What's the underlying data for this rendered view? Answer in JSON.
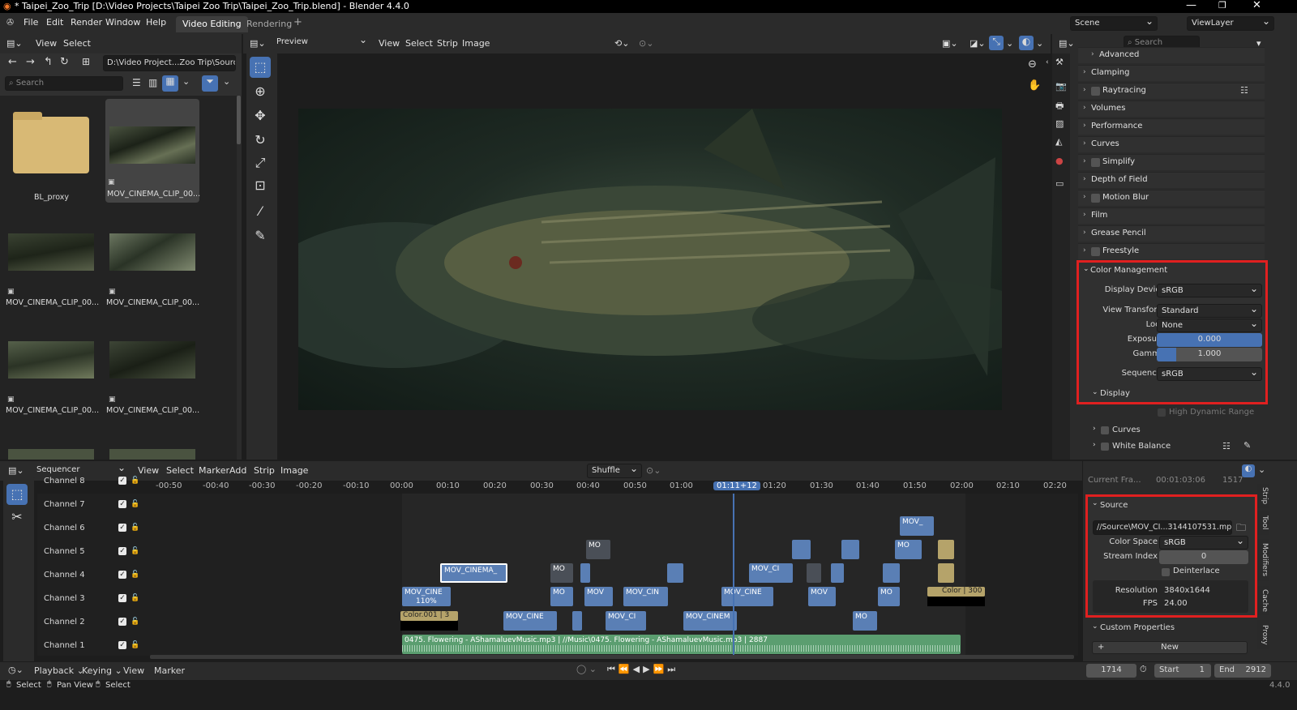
{
  "window": {
    "title": "* Taipei_Zoo_Trip [D:\\Video Projects\\Taipei Zoo Trip\\Taipei_Zoo_Trip.blend] - Blender 4.4.0"
  },
  "menu": {
    "items": [
      "File",
      "Edit",
      "Render",
      "Window",
      "Help"
    ],
    "tabs": [
      "Video Editing",
      "Rendering"
    ],
    "add_tab": "+",
    "scene": "Scene",
    "view_layer": "ViewLayer"
  },
  "filebrowser": {
    "menu": [
      "View",
      "Select"
    ],
    "path": "D:\\Video Project...Zoo Trip\\Source\\",
    "search_placeholder": "Search",
    "items": [
      {
        "name": "BL_proxy"
      },
      {
        "name": "MOV_CINEMA_CLIP_00..."
      },
      {
        "name": "MOV_CINEMA_CLIP_00..."
      },
      {
        "name": "MOV_CINEMA_CLIP_00..."
      },
      {
        "name": "MOV_CINEMA_CLIP_00..."
      },
      {
        "name": "MOV_CINEMA_CLIP_00..."
      }
    ]
  },
  "preview": {
    "mode": "Preview",
    "menu": [
      "View",
      "Select",
      "Strip",
      "Image"
    ]
  },
  "properties": {
    "search_placeholder": "Search",
    "panels": [
      {
        "label": "Advanced",
        "indent": true,
        "check": false
      },
      {
        "label": "Clamping",
        "indent": false,
        "check": false
      },
      {
        "label": "Raytracing",
        "indent": false,
        "check": true
      },
      {
        "label": "Volumes",
        "indent": false,
        "check": false
      },
      {
        "label": "Performance",
        "indent": false,
        "check": false
      },
      {
        "label": "Curves",
        "indent": false,
        "check": false
      },
      {
        "label": "Simplify",
        "indent": false,
        "check": true
      },
      {
        "label": "Depth of Field",
        "indent": false,
        "check": false
      },
      {
        "label": "Motion Blur",
        "indent": false,
        "check": true
      },
      {
        "label": "Film",
        "indent": false,
        "check": false
      },
      {
        "label": "Grease Pencil",
        "indent": false,
        "check": false
      },
      {
        "label": "Freestyle",
        "indent": false,
        "check": true
      }
    ],
    "color_management": {
      "title": "Color Management",
      "display_device_label": "Display Device",
      "display_device": "sRGB",
      "view_transform_label": "View Transform",
      "view_transform": "Standard",
      "look_label": "Look",
      "look": "None",
      "exposure_label": "Exposure",
      "exposure": "0.000",
      "gamma_label": "Gamma",
      "gamma": "1.000",
      "sequencer_label": "Sequencer",
      "sequencer": "sRGB",
      "display_label": "Display",
      "hdr_label": "High Dynamic Range",
      "curves_label": "Curves",
      "white_balance_label": "White Balance"
    }
  },
  "sequencer": {
    "mode": "Sequencer",
    "menu": [
      "View",
      "Select",
      "Marker",
      "Add",
      "Strip",
      "Image"
    ],
    "snap": "Shuffle",
    "ruler": [
      "-00:50",
      "-00:40",
      "-00:30",
      "-00:20",
      "-00:10",
      "00:00",
      "00:10",
      "00:20",
      "00:30",
      "00:40",
      "00:50",
      "01:00",
      "01:11+12",
      "01:20",
      "01:30",
      "01:40",
      "01:50",
      "02:00",
      "02:10",
      "02:20"
    ],
    "channels": [
      "Channel 8",
      "Channel 7",
      "Channel 6",
      "Channel 5",
      "Channel 4",
      "Channel 3",
      "Channel 2",
      "Channel 1"
    ],
    "strips": {
      "s4a": "MOV_CINEMA_",
      "s3a": "MOV_CINE",
      "s3a_pct": "110%",
      "color001": "Color.001 | 3",
      "s2a": "MOV_CINE",
      "s5a": "MO",
      "s4b": "MO",
      "s3b": "MO",
      "s3c": "MOV",
      "s3d": "MOV_CIN",
      "s2b": "MOV_CI",
      "s3e": "MOV_CINE",
      "s2c": "MOV_CINEM",
      "s4c": "MOV_CI",
      "s3f": "MOV",
      "s2d": "MO",
      "s6a": "MOV_",
      "s5b": "MO",
      "s3g": "MO",
      "color": "Color | 300",
      "audio": "0475. Flowering - AShamaluevMusic.mp3 | //Music\\0475. Flowering - AShamaluevMusic.mp3 | 2887"
    }
  },
  "strip_props": {
    "current_frame_label": "Current Fra...",
    "current_frame_time": "00:01:03:06",
    "current_frame": "1517",
    "source_title": "Source",
    "filepath": "//Source\\MOV_CI...3144107531.mp4",
    "color_space_label": "Color Space",
    "color_space": "sRGB",
    "stream_index_label": "Stream Index",
    "stream_index": "0",
    "deinterlace_label": "Deinterlace",
    "resolution_label": "Resolution",
    "resolution": "3840x1644",
    "fps_label": "FPS",
    "fps": "24.00",
    "custom_props_title": "Custom Properties",
    "new_label": "New",
    "tabs": [
      "Strip",
      "Tool",
      "Modifiers",
      "Cache",
      "Proxy"
    ]
  },
  "timeline": {
    "menu": [
      "Playback",
      "Keying",
      "View",
      "Marker"
    ],
    "frame": "1714",
    "start_label": "Start",
    "start": "1",
    "end_label": "End",
    "end": "2912"
  },
  "statusbar": {
    "items": [
      "Select",
      "Pan View",
      "Select"
    ],
    "version": "4.4.0"
  },
  "colors": {
    "accent": "#4772b3",
    "highlight": "#e02020",
    "strip": "#5a7fb5",
    "audio": "#5b9e70"
  }
}
